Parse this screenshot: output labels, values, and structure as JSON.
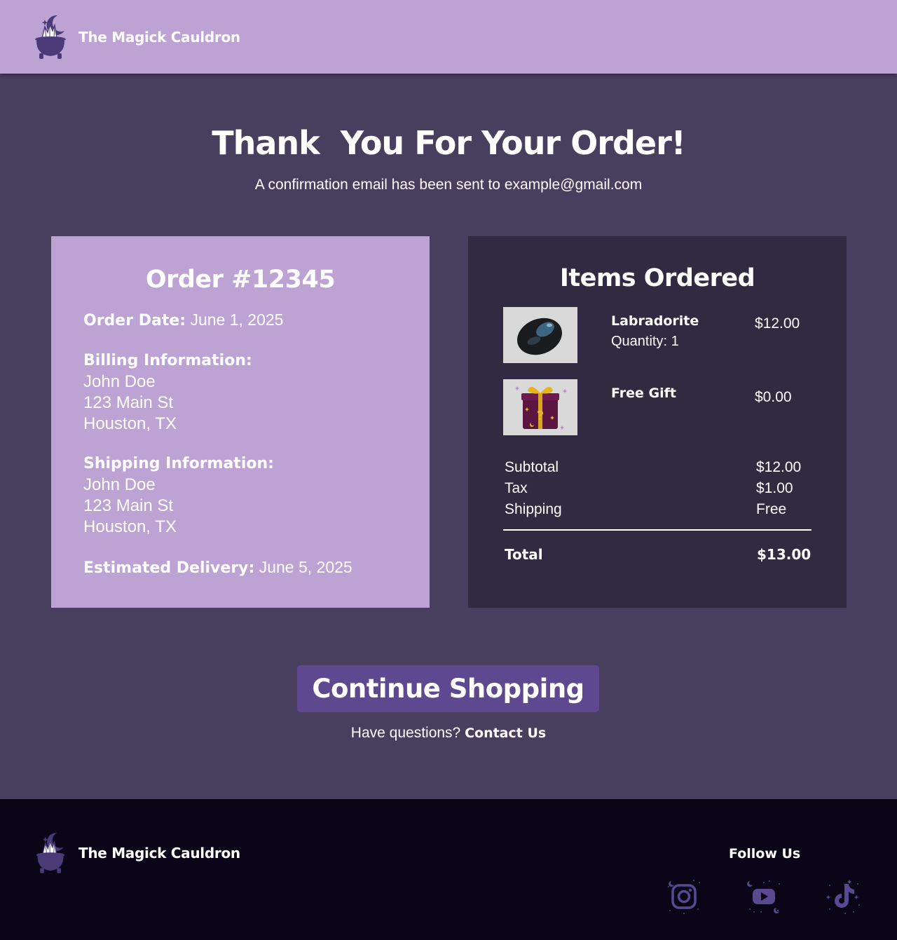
{
  "brand": {
    "name": "The Magick Cauldron",
    "logo_icon": "cauldron-crystals-moon-icon"
  },
  "hero": {
    "title": "Thank  You For Your Order!",
    "subtitle": "A confirmation email has been sent to example@gmail.com"
  },
  "order": {
    "title": "Order #12345",
    "date_label": "Order Date:",
    "date_value": "June 1, 2025",
    "billing": {
      "label": "Billing Information:",
      "name": "John Doe",
      "street": "123 Main St",
      "city": "Houston, TX"
    },
    "shipping": {
      "label": "Shipping Information:",
      "name": "John Doe",
      "street": "123 Main St",
      "city": "Houston, TX"
    },
    "delivery_label": "Estimated Delivery:",
    "delivery_value": "June 5, 2025"
  },
  "items": {
    "title": "Items Ordered",
    "list": [
      {
        "name": "Labradorite",
        "quantity": "Quantity: 1",
        "price": "$12.00",
        "image_icon": "labradorite-stone-image"
      },
      {
        "name": "Free Gift",
        "quantity": "",
        "price": "$0.00",
        "image_icon": "mystery-gift-box-image"
      }
    ],
    "subtotal_label": "Subtotal",
    "subtotal_value": "$12.00",
    "tax_label": "Tax",
    "tax_value": "$1.00",
    "shipping_label": "Shipping",
    "shipping_value": "Free",
    "total_label": "Total",
    "total_value": "$13.00"
  },
  "cta": {
    "label": "Continue Shopping"
  },
  "questions": {
    "text": "Have questions?",
    "link": "Contact Us"
  },
  "footer": {
    "follow_title": "Follow Us",
    "socials": [
      "instagram-icon",
      "youtube-icon",
      "tiktok-icon"
    ]
  },
  "colors": {
    "header_bg": "#bda2d4",
    "page_bg": "#483e5e",
    "items_card_bg": "#302b40",
    "cta_bg": "#5e4890",
    "footer_bg": "#0a0618",
    "icon_purple": "#4a3a78"
  }
}
